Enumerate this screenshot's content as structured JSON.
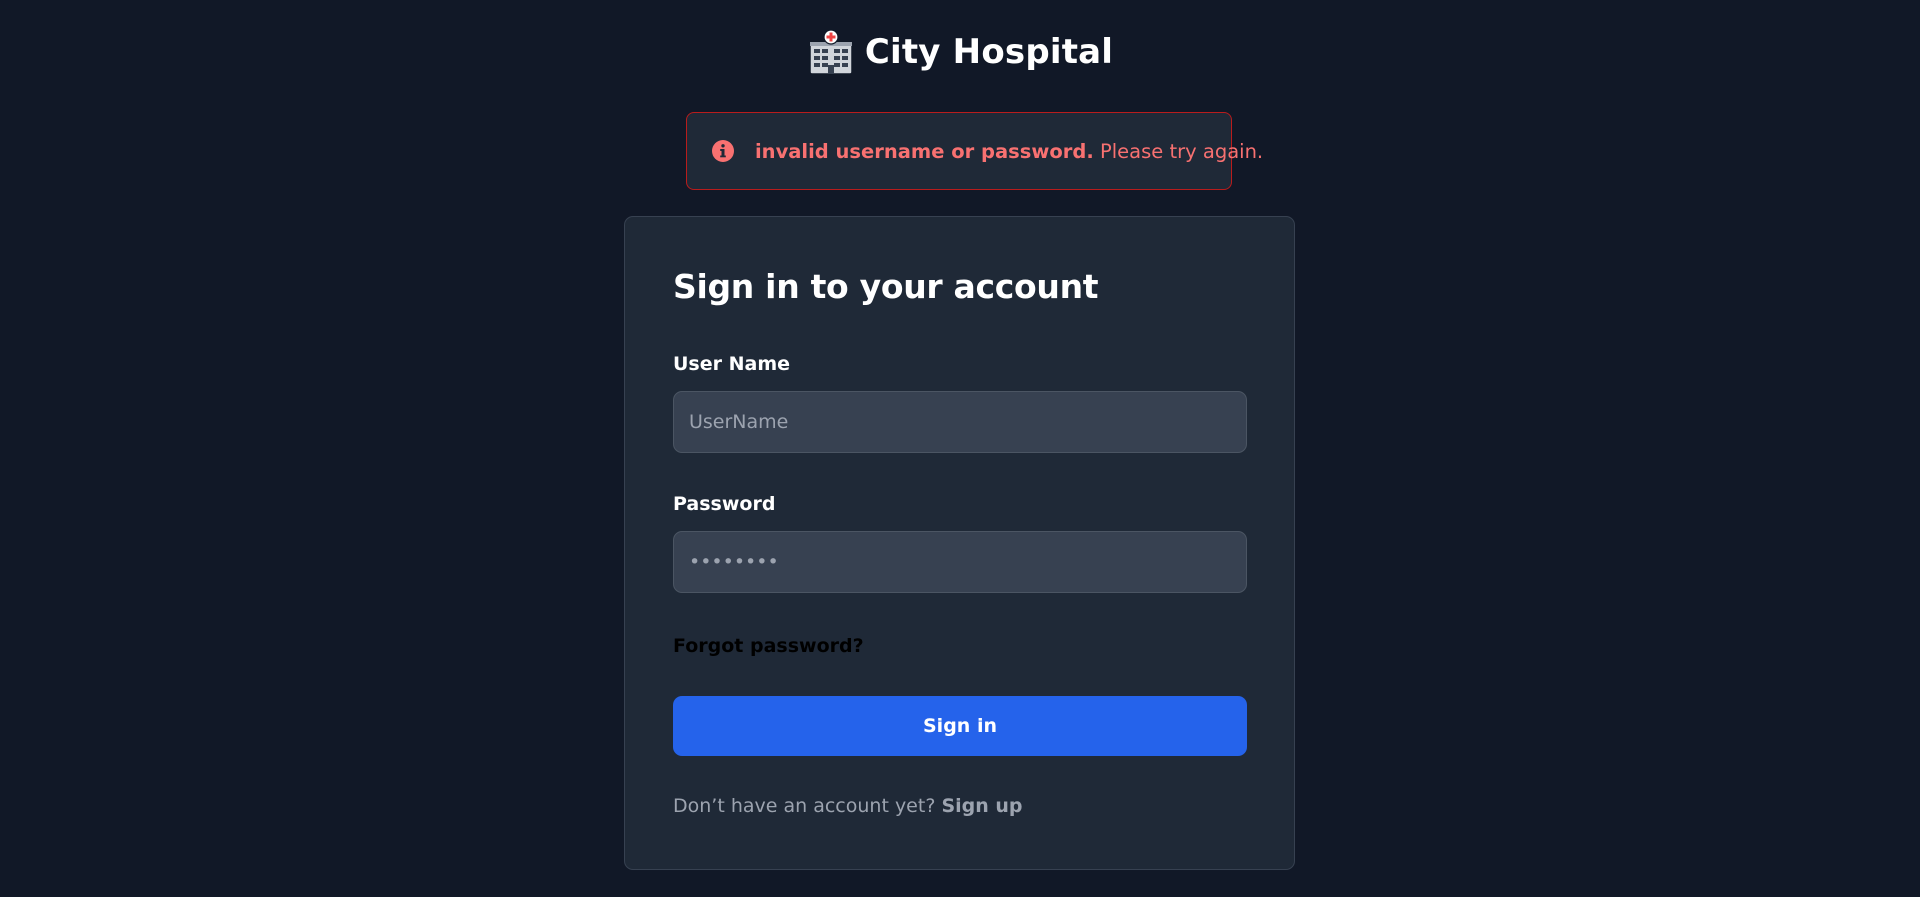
{
  "brand": {
    "icon": "hospital-building-icon",
    "title": "City Hospital"
  },
  "alert": {
    "icon": "info-circle-icon",
    "strong": "invalid username or password.",
    "message": " Please try again.",
    "color": "#f87171",
    "border_color": "#b91c1c"
  },
  "form": {
    "title": "Sign in to your account",
    "username_label": "User Name",
    "username_placeholder": "UserName",
    "username_value": "",
    "password_label": "Password",
    "password_value": "••••••••",
    "forgot_link": "Forgot password?",
    "submit_label": "Sign in",
    "signup_prompt": "Don’t have an account yet?",
    "signup_link": "Sign up"
  },
  "colors": {
    "background": "#111827",
    "card": "#1f2937",
    "input": "#374151",
    "primary": "#2563eb"
  }
}
